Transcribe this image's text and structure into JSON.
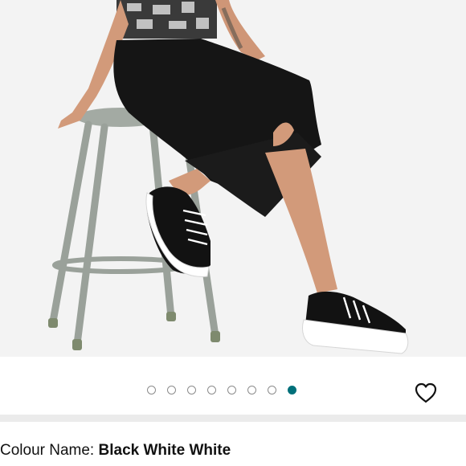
{
  "product_image": {
    "alt_semantic": "model-sitting-on-stool-wearing-black-platform-sneakers",
    "background_color": "#f3f3f3"
  },
  "carousel": {
    "total_images": 8,
    "active_index": 7,
    "active_color": "#00707a",
    "inactive_border_color": "#8c8c8c"
  },
  "wishlist": {
    "icon": "heart-outline-icon"
  },
  "variation": {
    "label": "Colour Name: ",
    "value": "Black White White"
  }
}
